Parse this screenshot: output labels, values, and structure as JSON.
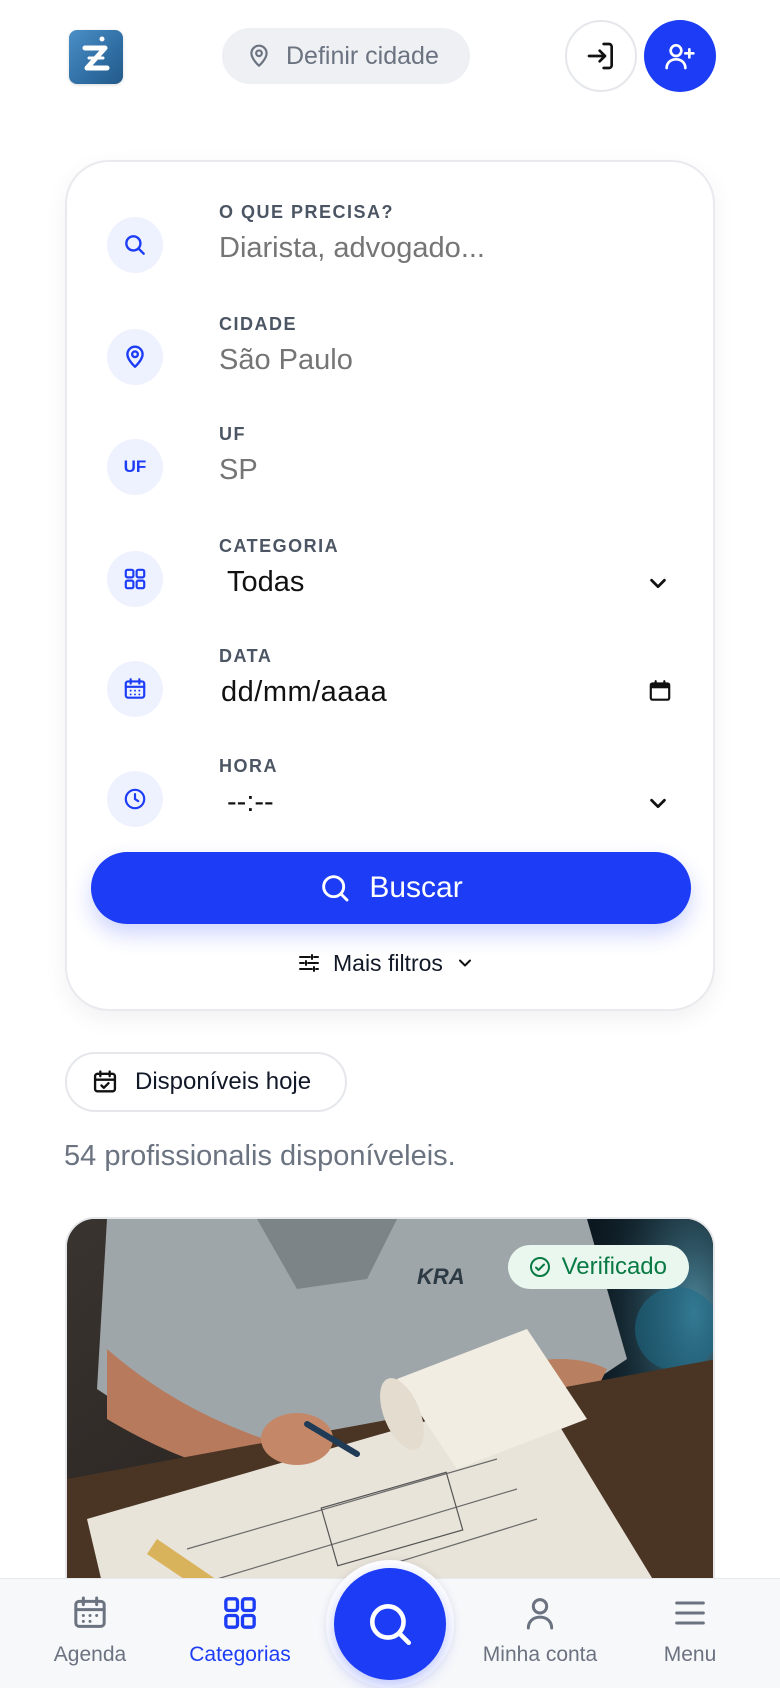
{
  "header": {
    "city_placeholder": "Definir cidade"
  },
  "search": {
    "need_label": "O QUE PRECISA?",
    "need_placeholder": "Diarista, advogado...",
    "city_label": "CIDADE",
    "city_placeholder": "São Paulo",
    "uf_label": "UF",
    "uf_badge": "UF",
    "uf_placeholder": "SP",
    "category_label": "CATEGORIA",
    "category_value": "Todas",
    "date_label": "DATA",
    "date_value": "dd/mm/aaaa",
    "time_label": "HORA",
    "time_value": "--:--",
    "search_button": "Buscar",
    "more_filters": "Mais filtros"
  },
  "filters": {
    "available_today": "Disponíveis hoje"
  },
  "results": {
    "count_text": "54 profissionalis disponíveleis."
  },
  "card": {
    "verified_badge": "Verificado"
  },
  "bottom_nav": {
    "items": [
      {
        "label": "Agenda",
        "icon": "calendar-icon"
      },
      {
        "label": "Categorias",
        "icon": "grid-icon",
        "active": true
      },
      {
        "label": "Minha conta",
        "icon": "user-icon"
      },
      {
        "label": "Menu",
        "icon": "menu-icon"
      }
    ]
  },
  "colors": {
    "primary": "#1d3cf5",
    "icon_bg": "#eef2fe",
    "verified_text": "#0a7a44",
    "verified_bg": "#e9f7ef",
    "muted_text": "#6b7280"
  }
}
